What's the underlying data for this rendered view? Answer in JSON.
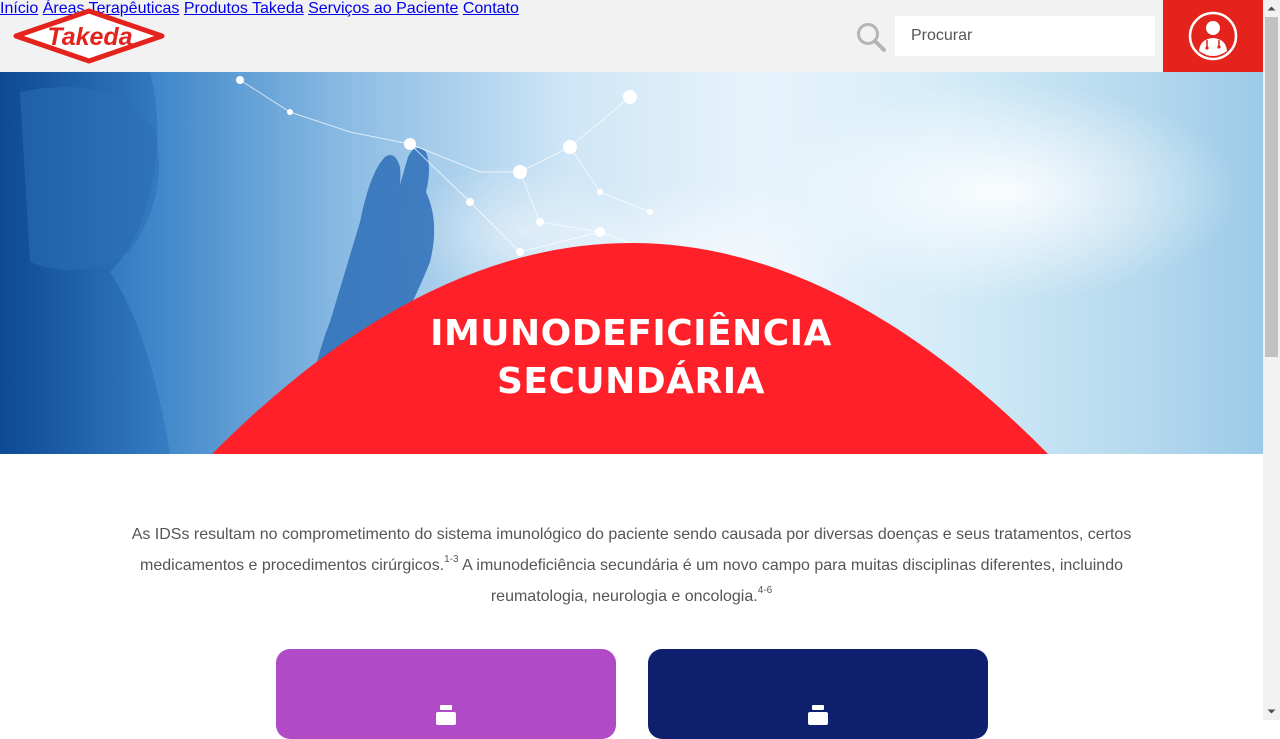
{
  "header": {
    "logo_text": "Takeda",
    "nav": [
      "Início",
      "Áreas Terapêuticas",
      "Produtos Takeda",
      "Serviços ao Paciente",
      "Contato"
    ],
    "search_placeholder": "Procurar",
    "search_icon": "search-icon",
    "hcp_icon": "doctor-profile-icon"
  },
  "hero": {
    "title_line1": "IMUNODEFICIÊNCIA",
    "title_line2": "SECUNDÁRIA"
  },
  "intro": {
    "part1": "As IDSs resultam no comprometimento do sistema imunológico do paciente sendo causada por diversas doenças e seus tratamentos, certos medicamentos e procedimentos cirúrgicos.",
    "sup1": "1-3",
    "part2": " A imunodeficiência secundária é um novo campo para muitas disciplinas diferentes, incluindo reumatologia, neurologia e oncologia.",
    "sup2": "4-6"
  },
  "cards": [
    {
      "color": "#b04ac7",
      "icon": "medicine-bottle-icon"
    },
    {
      "color": "#0e1f6e",
      "icon": "medicine-bottle-icon"
    }
  ],
  "colors": {
    "brand_red": "#e3231c",
    "header_bg": "#f2f2f2",
    "text": "#555555"
  }
}
